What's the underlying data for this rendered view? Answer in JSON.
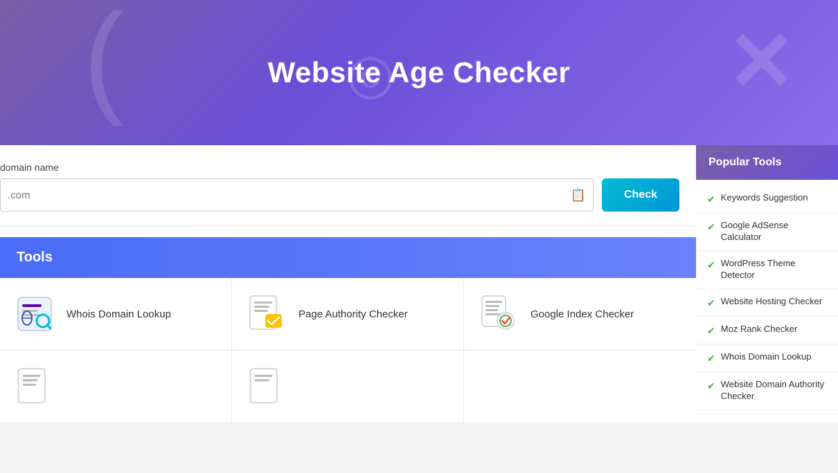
{
  "hero": {
    "title": "Website Age Checker"
  },
  "search": {
    "label": "domain name",
    "placeholder": ".com",
    "button_label": "Check"
  },
  "tools_section": {
    "heading": "Tools"
  },
  "tools": [
    {
      "id": "whois",
      "name": "Whois Domain Lookup",
      "icon": "whois"
    },
    {
      "id": "page-authority",
      "name": "Page Authority Checker",
      "icon": "page-authority"
    },
    {
      "id": "google-index",
      "name": "Google Index Checker",
      "icon": "google-index"
    },
    {
      "id": "tool4",
      "name": "",
      "icon": "generic"
    },
    {
      "id": "tool5",
      "name": "",
      "icon": "generic2"
    }
  ],
  "sidebar": {
    "header": "Popular Tools",
    "items": [
      {
        "label": "Keywords Suggestion"
      },
      {
        "label": "Google AdSense Calculator"
      },
      {
        "label": "WordPress Theme Detector"
      },
      {
        "label": "Website Hosting Checker"
      },
      {
        "label": "Moz Rank Checker"
      },
      {
        "label": "Whois Domain Lookup"
      },
      {
        "label": "Website Domain Authority Checker"
      }
    ]
  }
}
